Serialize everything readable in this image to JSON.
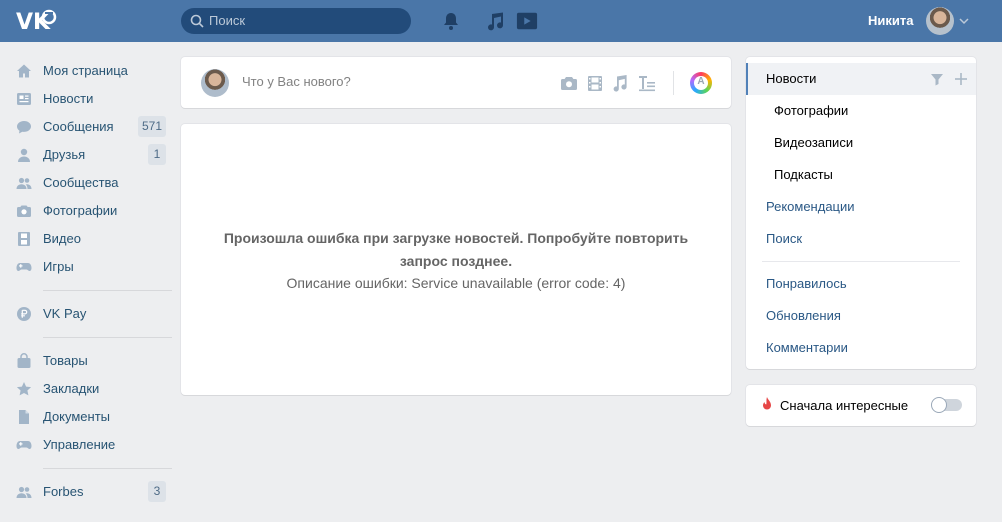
{
  "header": {
    "logo": "vk-logo",
    "search_placeholder": "Поиск",
    "user_name": "Никита",
    "icons": [
      "bell-icon",
      "music-icon",
      "play-icon"
    ]
  },
  "leftnav": {
    "items": [
      {
        "label": "Моя страница",
        "icon": "home-icon"
      },
      {
        "label": "Новости",
        "icon": "newspaper-icon"
      },
      {
        "label": "Сообщения",
        "icon": "messages-icon",
        "badge": "571"
      },
      {
        "label": "Друзья",
        "icon": "user-icon",
        "badge": "1"
      },
      {
        "label": "Сообщества",
        "icon": "groups-icon"
      },
      {
        "label": "Фотографии",
        "icon": "camera-icon"
      },
      {
        "label": "Видео",
        "icon": "film-icon"
      },
      {
        "label": "Игры",
        "icon": "gamepad-icon"
      },
      {
        "label": "VK Pay",
        "icon": "ruble-icon"
      },
      {
        "label": "Товары",
        "icon": "bag-icon"
      },
      {
        "label": "Закладки",
        "icon": "star-icon"
      },
      {
        "label": "Документы",
        "icon": "document-icon"
      },
      {
        "label": "Управление",
        "icon": "gamepad-icon"
      },
      {
        "label": "Forbes",
        "icon": "groups-icon",
        "badge": "3"
      }
    ]
  },
  "composer": {
    "placeholder": "Что у Вас нового?",
    "icons": [
      "camera-icon",
      "film-icon",
      "music-icon",
      "text-icon",
      "avatar-icon"
    ],
    "badge_letter": "A"
  },
  "feed_error": {
    "title": "Произошла ошибка при загрузке новостей. Попробуйте повторить запрос позднее.",
    "description": "Описание ошибки: Service unavailable (error code: 4)"
  },
  "filters": {
    "items": [
      {
        "label": "Новости",
        "active": true
      },
      {
        "label": "Фотографии"
      },
      {
        "label": "Видеозаписи"
      },
      {
        "label": "Подкасты"
      },
      {
        "label": "Рекомендации"
      },
      {
        "label": "Поиск"
      },
      {
        "label": "Понравилось"
      },
      {
        "label": "Обновления"
      },
      {
        "label": "Комментарии"
      }
    ],
    "toggle_label": "Сначала интересные",
    "toggle_on": false
  },
  "colors": {
    "header": "#4a76a8",
    "link": "#285473",
    "accent": "#5181b8",
    "background": "#edeef0"
  }
}
